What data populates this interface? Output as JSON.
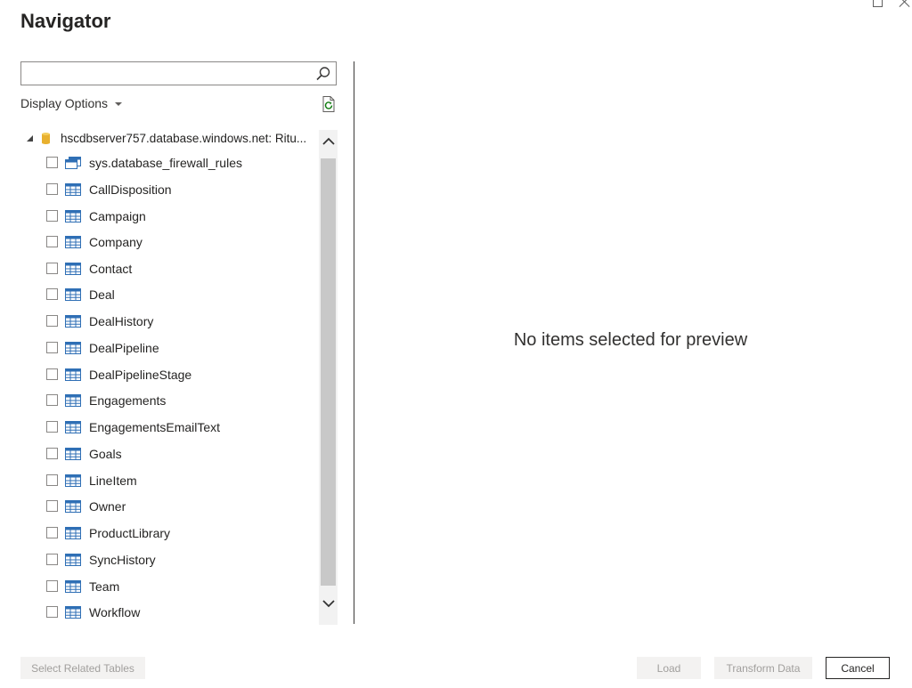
{
  "window": {
    "title": "Navigator",
    "controls": {
      "maximize_icon": "maximize-icon",
      "close_icon": "close-icon"
    }
  },
  "search": {
    "value": "",
    "placeholder": "",
    "icon": "search-icon"
  },
  "display_options": {
    "label": "Display Options",
    "icon": "chevron-down-icon"
  },
  "refresh": {
    "icon": "refresh-icon"
  },
  "tree": {
    "root": {
      "label": "hscdbserver757.database.windows.net: Ritu...",
      "icon": "database-icon",
      "expanded": true
    },
    "items": [
      {
        "label": "sys.database_firewall_rules",
        "icon": "view-icon",
        "checked": false
      },
      {
        "label": "CallDisposition",
        "icon": "table-icon",
        "checked": false
      },
      {
        "label": "Campaign",
        "icon": "table-icon",
        "checked": false
      },
      {
        "label": "Company",
        "icon": "table-icon",
        "checked": false
      },
      {
        "label": "Contact",
        "icon": "table-icon",
        "checked": false
      },
      {
        "label": "Deal",
        "icon": "table-icon",
        "checked": false
      },
      {
        "label": "DealHistory",
        "icon": "table-icon",
        "checked": false
      },
      {
        "label": "DealPipeline",
        "icon": "table-icon",
        "checked": false
      },
      {
        "label": "DealPipelineStage",
        "icon": "table-icon",
        "checked": false
      },
      {
        "label": "Engagements",
        "icon": "table-icon",
        "checked": false
      },
      {
        "label": "EngagementsEmailText",
        "icon": "table-icon",
        "checked": false
      },
      {
        "label": "Goals",
        "icon": "table-icon",
        "checked": false
      },
      {
        "label": "LineItem",
        "icon": "table-icon",
        "checked": false
      },
      {
        "label": "Owner",
        "icon": "table-icon",
        "checked": false
      },
      {
        "label": "ProductLibrary",
        "icon": "table-icon",
        "checked": false
      },
      {
        "label": "SyncHistory",
        "icon": "table-icon",
        "checked": false
      },
      {
        "label": "Team",
        "icon": "table-icon",
        "checked": false
      },
      {
        "label": "Workflow",
        "icon": "table-icon",
        "checked": false
      }
    ]
  },
  "preview": {
    "message": "No items selected for preview"
  },
  "footer": {
    "select_related_label": "Select Related Tables",
    "load_label": "Load",
    "transform_label": "Transform Data",
    "cancel_label": "Cancel"
  },
  "colors": {
    "table_icon_blue": "#2f6fb5",
    "database_gold": "#e8b02e",
    "disabled_button_bg": "#f3f2f1",
    "disabled_text": "#a19f9d"
  }
}
